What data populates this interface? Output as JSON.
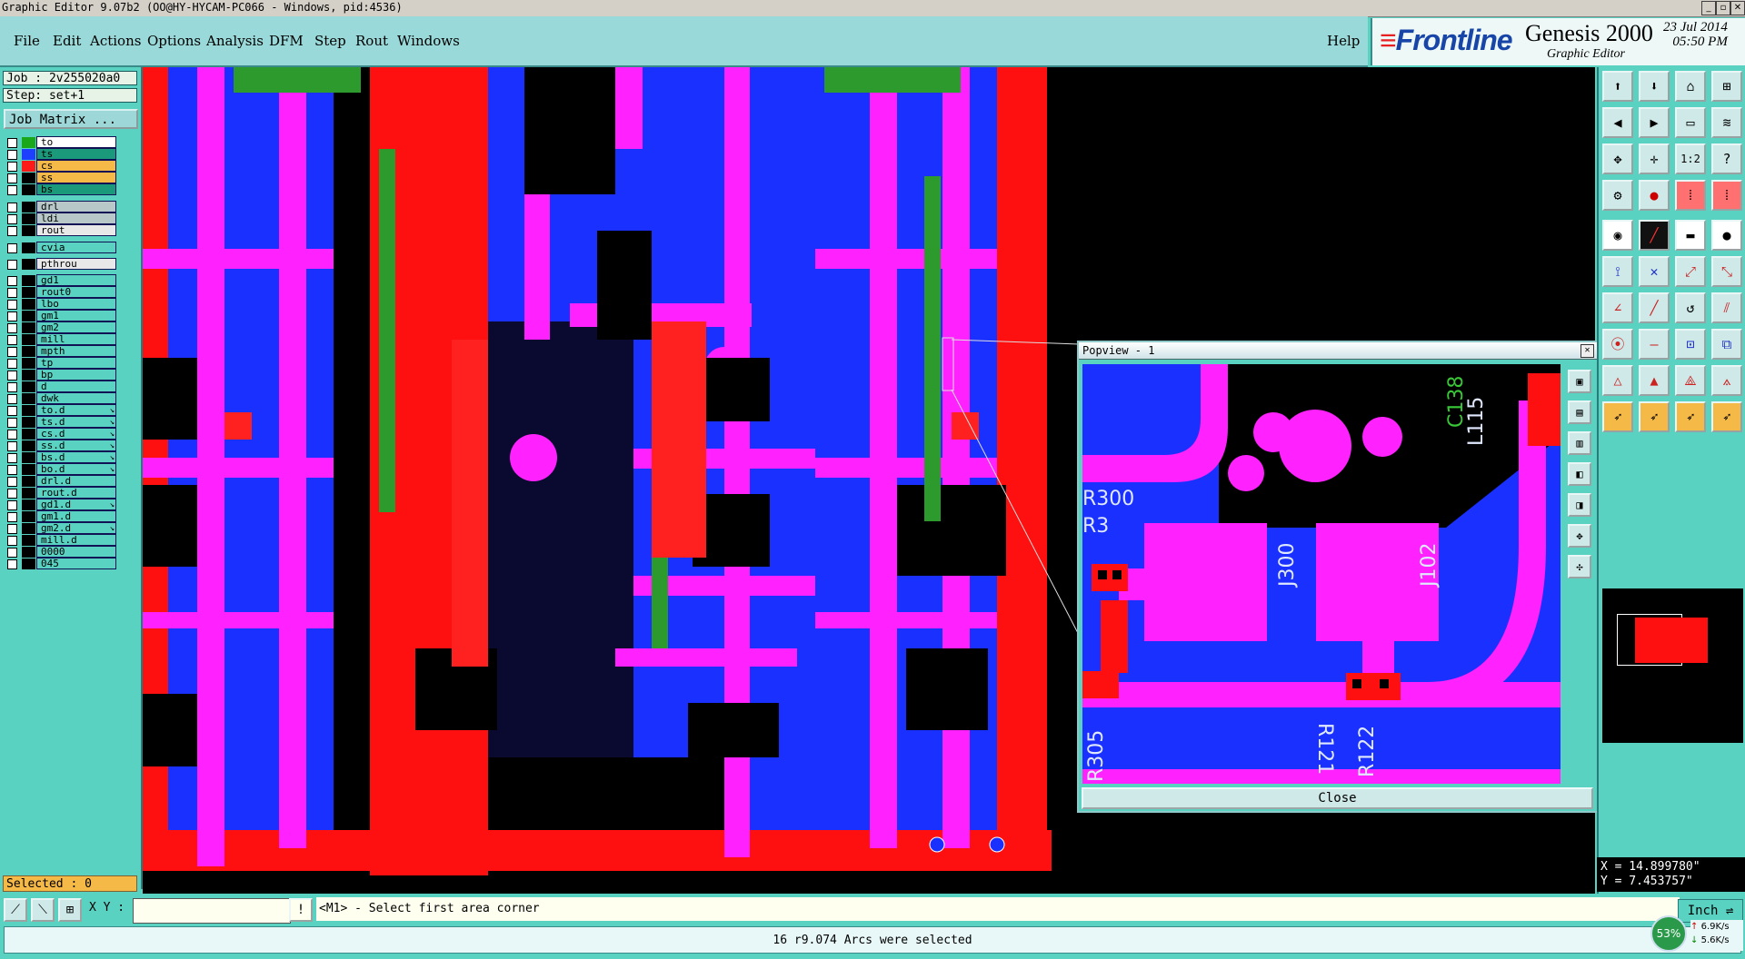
{
  "window": {
    "title": "Graphic Editor 9.07b2 (OO@HY-HYCAM-PC066 - Windows, pid:4536)"
  },
  "menu": {
    "items": [
      "File",
      "Edit",
      "Actions",
      "Options",
      "Analysis",
      "DFM",
      "Step",
      "Rout",
      "Windows"
    ],
    "help": "Help"
  },
  "brand": {
    "logo": "Frontline",
    "product": "Genesis 2000",
    "subtitle": "Graphic Editor",
    "date": "23 Jul 2014",
    "time": "05:50 PM"
  },
  "job": {
    "job_label": "Job : 2v255020a0",
    "step_label": "Step: set+1",
    "matrix_button": "Job Matrix ..."
  },
  "layers": [
    {
      "name": "to",
      "color": "#1aa81a",
      "box": "#ffffff"
    },
    {
      "name": "ts",
      "color": "#1f3fff",
      "box": "#1a9a7a"
    },
    {
      "name": "cs",
      "color": "#ff1a1a",
      "box": "#f5b948"
    },
    {
      "name": "ss",
      "color": "#000000",
      "box": "#f5b948"
    },
    {
      "name": "bs",
      "color": "#000000",
      "box": "#1a9a7a"
    },
    {
      "name": "drl",
      "color": "#000000",
      "box": "#b8c8c8"
    },
    {
      "name": "ldi",
      "color": "#000000",
      "box": "#b8c8c8"
    },
    {
      "name": "rout",
      "color": "#000000",
      "box": "#e8e8e8"
    },
    {
      "name": "cvia",
      "color": "#000000",
      "box": "#5ad2c2"
    },
    {
      "name": "pthrou",
      "color": "#000000",
      "box": "#e8e8e8"
    },
    {
      "name": "gd1",
      "color": "#000000",
      "box": "#5ad2c2"
    },
    {
      "name": "rout0",
      "color": "#000000",
      "box": "#5ad2c2"
    },
    {
      "name": "lbo",
      "color": "#000000",
      "box": "#5ad2c2"
    },
    {
      "name": "gm1",
      "color": "#000000",
      "box": "#5ad2c2"
    },
    {
      "name": "gm2",
      "color": "#000000",
      "box": "#5ad2c2"
    },
    {
      "name": "mill",
      "color": "#000000",
      "box": "#5ad2c2"
    },
    {
      "name": "mpth",
      "color": "#000000",
      "box": "#5ad2c2"
    },
    {
      "name": "tp",
      "color": "#000000",
      "box": "#5ad2c2"
    },
    {
      "name": "bp",
      "color": "#000000",
      "box": "#5ad2c2"
    },
    {
      "name": "d",
      "color": "#000000",
      "box": "#5ad2c2"
    },
    {
      "name": "dwk",
      "color": "#000000",
      "box": "#5ad2c2"
    },
    {
      "name": "to.d",
      "color": "#000000",
      "box": "#5ad2c2",
      "mark": "↘"
    },
    {
      "name": "ts.d",
      "color": "#000000",
      "box": "#5ad2c2",
      "mark": "↘"
    },
    {
      "name": "cs.d",
      "color": "#000000",
      "box": "#5ad2c2",
      "mark": "↘"
    },
    {
      "name": "ss.d",
      "color": "#000000",
      "box": "#5ad2c2",
      "mark": "↘"
    },
    {
      "name": "bs.d",
      "color": "#000000",
      "box": "#5ad2c2",
      "mark": "↘"
    },
    {
      "name": "bo.d",
      "color": "#000000",
      "box": "#5ad2c2",
      "mark": "↘"
    },
    {
      "name": "drl.d",
      "color": "#000000",
      "box": "#5ad2c2"
    },
    {
      "name": "rout.d",
      "color": "#000000",
      "box": "#5ad2c2"
    },
    {
      "name": "gd1.d",
      "color": "#000000",
      "box": "#5ad2c2",
      "mark": "↘"
    },
    {
      "name": "gm1.d",
      "color": "#000000",
      "box": "#5ad2c2"
    },
    {
      "name": "gm2.d",
      "color": "#000000",
      "box": "#5ad2c2",
      "mark": "↘"
    },
    {
      "name": "mill.d",
      "color": "#000000",
      "box": "#5ad2c2"
    },
    {
      "name": "0000",
      "color": "#000000",
      "box": "#5ad2c2"
    },
    {
      "name": "045",
      "color": "#000000",
      "box": "#5ad2c2"
    }
  ],
  "selected": "Selected : 0",
  "popview": {
    "title": "Popview - 1",
    "close": "Close",
    "labels": {
      "c138": "C138",
      "l115": "L115",
      "r300": "R300",
      "r3": "R3",
      "j300": "J300",
      "j102": "J102",
      "r121": "R121",
      "r122": "R122",
      "r305": "R305"
    }
  },
  "coords": {
    "x": "X = 14.899780\"",
    "y": "Y = 7.453757\""
  },
  "command": {
    "xy_label": "X Y :",
    "prompt": "<M1> - Select first area corner",
    "units": "Inch"
  },
  "status": {
    "message": "16 r9.074 Arcs were selected",
    "cpu": "53%",
    "up": "6.9K/s",
    "down": "5.6K/s"
  },
  "pcb_labels": [
    "J300",
    "J102",
    "C138",
    "L115"
  ]
}
